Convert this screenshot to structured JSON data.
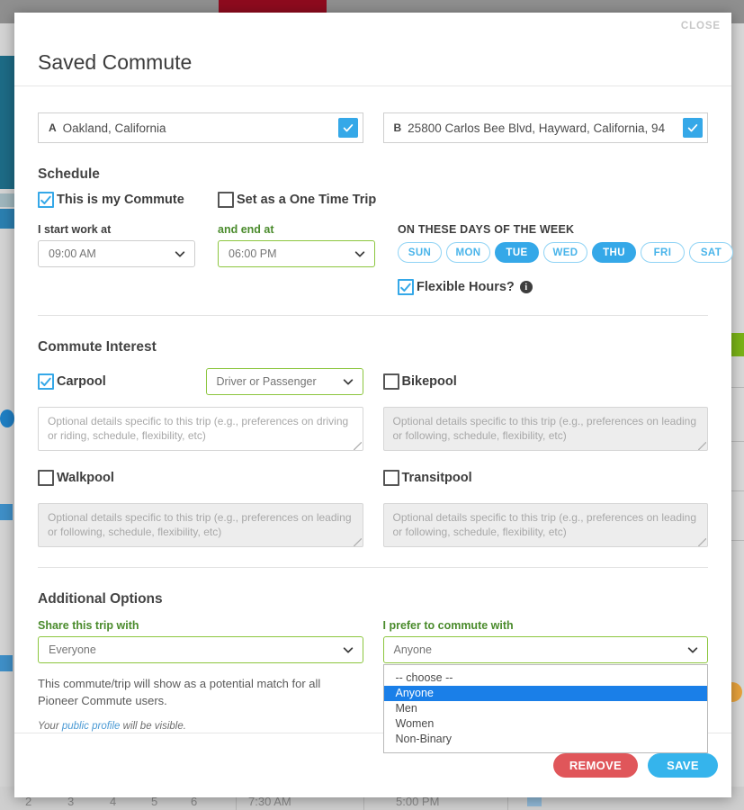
{
  "modal": {
    "title": "Saved Commute",
    "close_label": "CLOSE"
  },
  "locations": {
    "origin": {
      "letter": "A",
      "value": "Oakland, California",
      "confirmed_icon": "check-icon"
    },
    "destination": {
      "letter": "B",
      "value": "25800 Carlos Bee Blvd, Hayward, California, 94",
      "confirmed_icon": "check-icon"
    }
  },
  "schedule": {
    "heading": "Schedule",
    "is_commute_label": "This is my Commute",
    "is_commute_checked": true,
    "one_time_label": "Set as a One Time Trip",
    "one_time_checked": false,
    "start_label": "I start work at",
    "start_value": "09:00 AM",
    "end_label": "and end at",
    "end_value": "06:00 PM",
    "days_heading": "ON THESE DAYS OF THE WEEK",
    "days": [
      {
        "label": "SUN",
        "selected": false
      },
      {
        "label": "MON",
        "selected": false
      },
      {
        "label": "TUE",
        "selected": true
      },
      {
        "label": "WED",
        "selected": false
      },
      {
        "label": "THU",
        "selected": true
      },
      {
        "label": "FRI",
        "selected": false
      },
      {
        "label": "SAT",
        "selected": false
      }
    ],
    "flexible_label": "Flexible Hours?",
    "flexible_checked": true,
    "info_glyph": "i"
  },
  "commute_interest": {
    "heading": "Commute Interest",
    "carpool": {
      "label": "Carpool",
      "checked": true,
      "role_value": "Driver or Passenger",
      "notes_placeholder": "Optional details specific to this trip (e.g., preferences on driving or riding, schedule, flexibility, etc)"
    },
    "bikepool": {
      "label": "Bikepool",
      "checked": false,
      "notes_placeholder": "Optional details specific to this trip (e.g., preferences on leading or following, schedule, flexibility, etc)"
    },
    "walkpool": {
      "label": "Walkpool",
      "checked": false,
      "notes_placeholder": "Optional details specific to this trip (e.g., preferences on leading or following, schedule, flexibility, etc)"
    },
    "transitpool": {
      "label": "Transitpool",
      "checked": false,
      "notes_placeholder": "Optional details specific to this trip (e.g., preferences on leading or following, schedule, flexibility, etc)"
    }
  },
  "additional_options": {
    "heading": "Additional Options",
    "share_label": "Share this trip with",
    "share_value": "Everyone",
    "helper_text": "This commute/trip will show as a potential match for all Pioneer Commute users.",
    "fineprint_pre": "Your ",
    "fineprint_link": "public profile",
    "fineprint_post": " will be visible.",
    "prefer_label": "I prefer to commute with",
    "prefer_value": "Anyone",
    "prefer_options": [
      {
        "label": "-- choose --",
        "highlighted": false
      },
      {
        "label": "Anyone",
        "highlighted": true
      },
      {
        "label": "Men",
        "highlighted": false
      },
      {
        "label": "Women",
        "highlighted": false
      },
      {
        "label": "Non-Binary",
        "highlighted": false
      }
    ]
  },
  "footer": {
    "remove_label": "REMOVE",
    "save_label": "SAVE"
  },
  "colors": {
    "accent_blue": "#35a8e8",
    "green_border": "#8cc63e",
    "green_text": "#4a8b2c",
    "remove_red": "#e0565a",
    "dropdown_highlight": "#1a7fe8"
  },
  "background": {
    "table_numbers": [
      "2",
      "3",
      "4",
      "5",
      "6"
    ],
    "table_times": [
      "7:30 AM",
      "5:00 PM"
    ]
  }
}
